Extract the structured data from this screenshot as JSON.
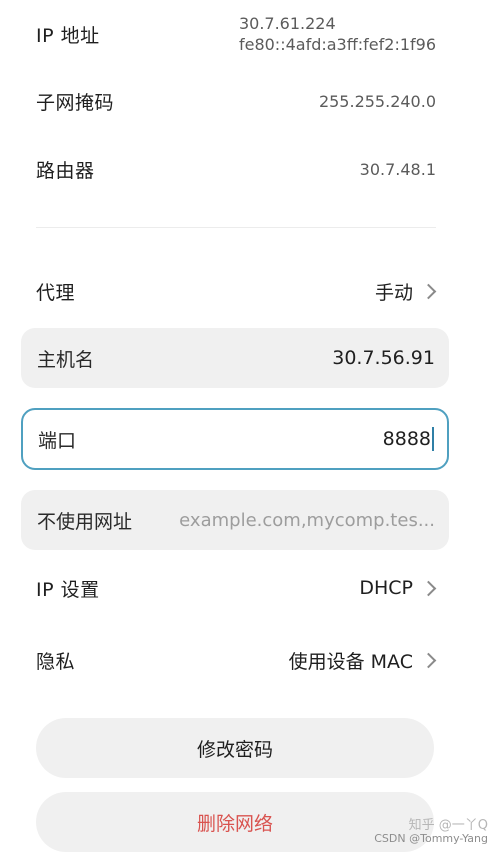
{
  "network_info": {
    "ip_address": {
      "label": "IP 地址",
      "value_v4": "30.7.61.224",
      "value_v6": "fe80::4afd:a3ff:fef2:1f96"
    },
    "subnet_mask": {
      "label": "子网掩码",
      "value": "255.255.240.0"
    },
    "router": {
      "label": "路由器",
      "value": "30.7.48.1"
    }
  },
  "proxy": {
    "label": "代理",
    "value": "手动"
  },
  "hostname_field": {
    "label": "主机名",
    "value": "30.7.56.91"
  },
  "port_field": {
    "label": "端口",
    "value": "8888"
  },
  "bypass_field": {
    "label": "不使用网址",
    "placeholder": "example.com,mycomp.tes..."
  },
  "ip_settings": {
    "label": "IP 设置",
    "value": "DHCP"
  },
  "privacy": {
    "label": "隐私",
    "value": "使用设备 MAC"
  },
  "actions": {
    "modify_password": "修改密码",
    "delete_network": "删除网络"
  },
  "colors": {
    "focus_border": "#4fa0c0",
    "danger_text": "#d9534f",
    "field_background": "#f0f0f0"
  },
  "watermark": {
    "line1": "知乎 @一丫Q",
    "line2": "CSDN @Tommy-Yang"
  }
}
